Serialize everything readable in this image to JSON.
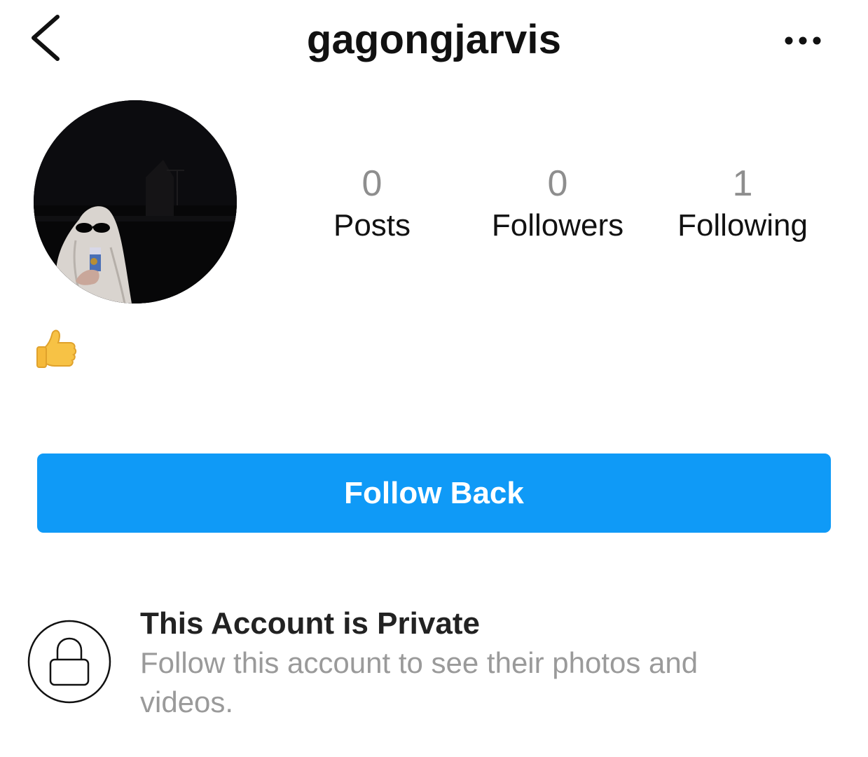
{
  "header": {
    "username": "gagongjarvis",
    "back_icon": "chevron-left-icon",
    "more_icon": "more-horizontal-icon"
  },
  "profile": {
    "avatar_description": "ghost-costume-with-sunglasses-profile-photo",
    "bio_emoji": "👍"
  },
  "stats": {
    "posts": {
      "count": "0",
      "label": "Posts"
    },
    "followers": {
      "count": "0",
      "label": "Followers"
    },
    "following": {
      "count": "1",
      "label": "Following"
    }
  },
  "actions": {
    "follow_back_label": "Follow Back",
    "follow_back_color": "#0f9af7"
  },
  "private_notice": {
    "icon": "lock-icon",
    "title": "This Account is Private",
    "description": "Follow this account to see their photos and videos."
  }
}
